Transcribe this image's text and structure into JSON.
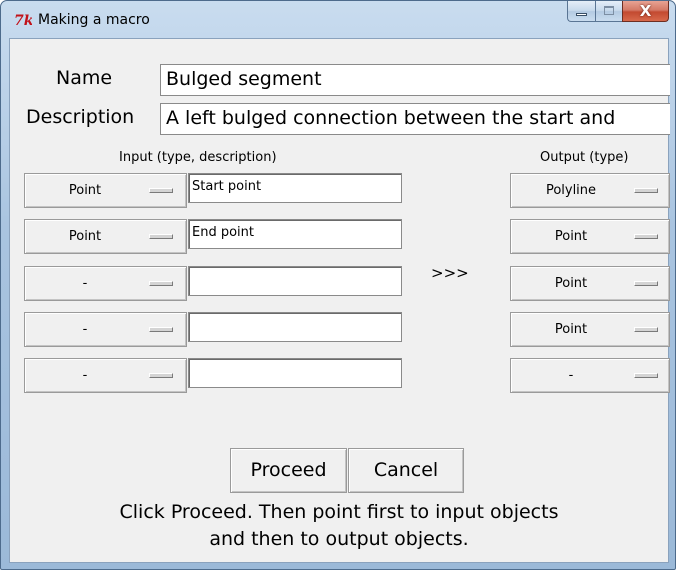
{
  "window": {
    "title": "Making a macro",
    "controls": {
      "minimize": "minimize",
      "maximize": "maximize",
      "close": "X"
    }
  },
  "form": {
    "name_label": "Name",
    "name_value": "Bulged segment",
    "description_label": "Description",
    "description_value": "A left bulged connection between the start and"
  },
  "input_header": "Input (type, description)",
  "output_header": "Output (type)",
  "inputs": [
    {
      "type": "Point",
      "description": "Start point"
    },
    {
      "type": "Point",
      "description": "End point"
    },
    {
      "type": "-",
      "description": ""
    },
    {
      "type": "-",
      "description": ""
    },
    {
      "type": "-",
      "description": ""
    }
  ],
  "outputs": [
    {
      "type": "Polyline"
    },
    {
      "type": "Point"
    },
    {
      "type": "Point"
    },
    {
      "type": "Point"
    },
    {
      "type": "-"
    }
  ],
  "arrows": ">>>",
  "buttons": {
    "proceed": "Proceed",
    "cancel": "Cancel"
  },
  "message": {
    "line1": "Click Proceed. Then point first to input objects",
    "line2": "and then to output objects."
  },
  "icons": {
    "app": "tk-feather-icon"
  }
}
